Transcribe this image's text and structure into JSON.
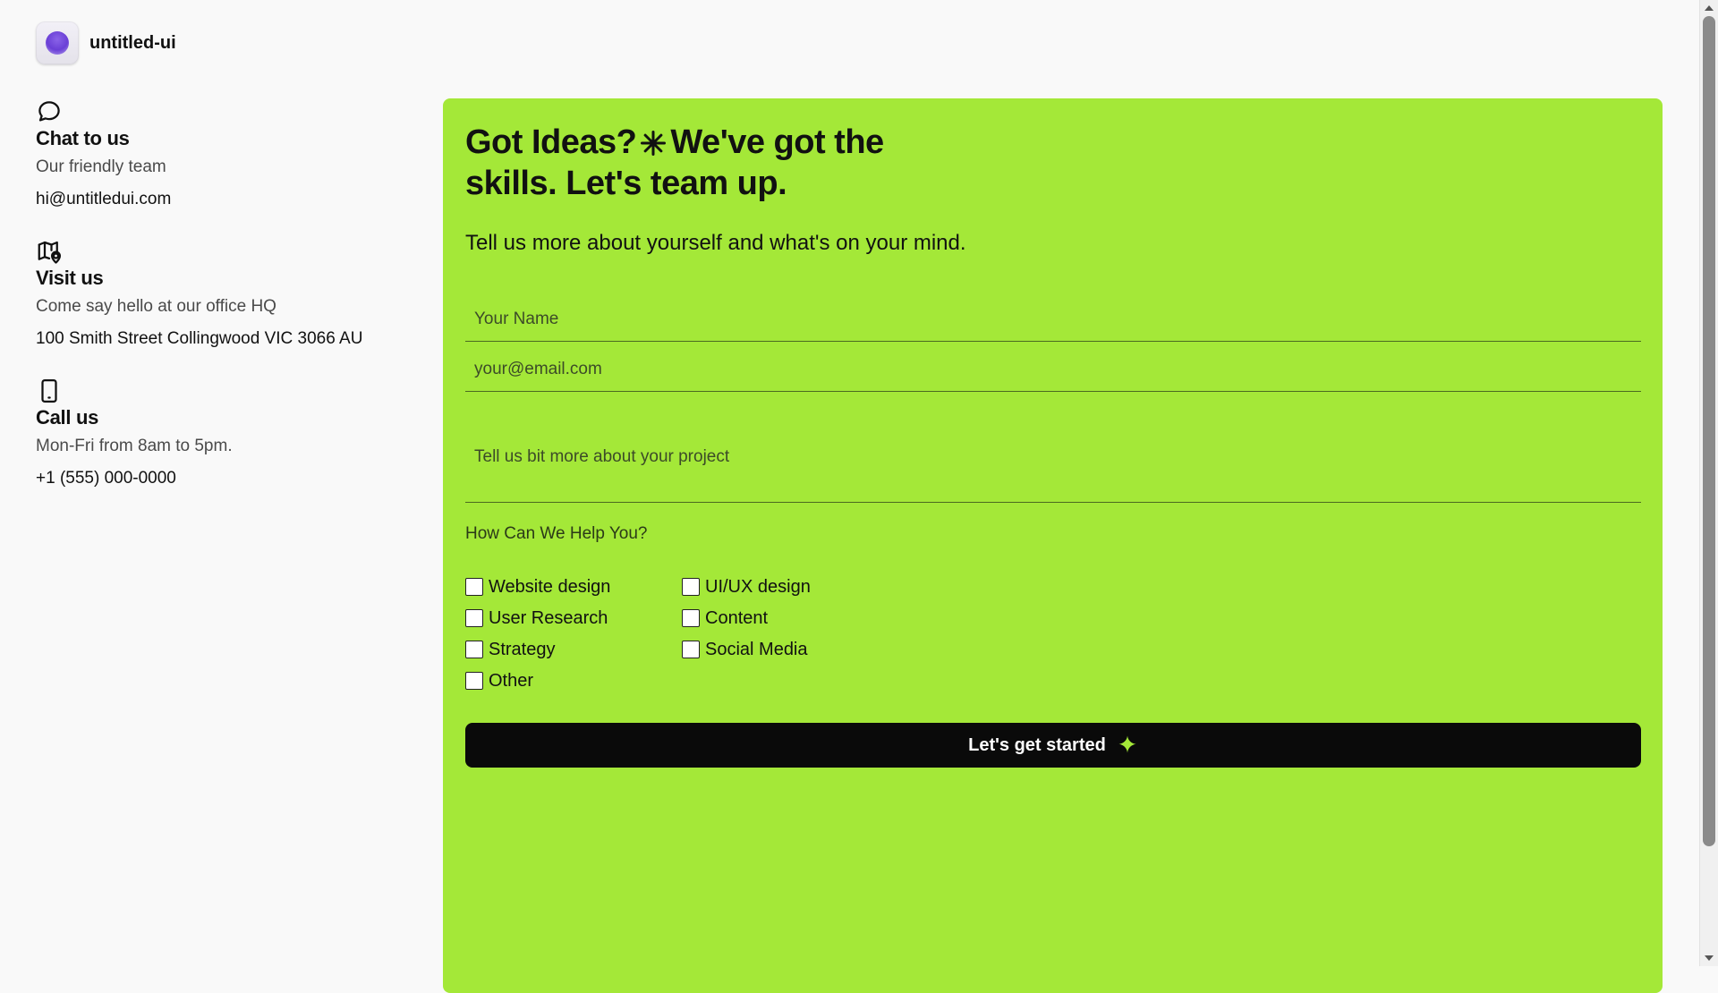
{
  "brand": {
    "name": "untitled-ui",
    "logo_icon": "gradient-circle-logo"
  },
  "contact": [
    {
      "icon": "chat-bubble-icon",
      "title": "Chat to us",
      "description": "Our friendly team",
      "value": "hi@untitledui.com"
    },
    {
      "icon": "map-pin-icon",
      "title": "Visit us",
      "description": "Come say hello at our office HQ",
      "value": "100 Smith Street Collingwood VIC 3066 AU"
    },
    {
      "icon": "phone-icon",
      "title": "Call us",
      "description": "Mon-Fri from 8am to 5pm.",
      "value": "+1 (555) 000-0000"
    }
  ],
  "form": {
    "headline_part1": "Got Ideas?",
    "headline_part2": "We've got the skills. Let's team up.",
    "subheading": "Tell us more about yourself and what's on your mind.",
    "name_placeholder": "Your Name",
    "email_placeholder": "your@email.com",
    "message_placeholder": "Tell us bit more about your project",
    "help_label": "How Can We Help You?",
    "options": [
      "Website design",
      "UI/UX design",
      "User Research",
      "Content",
      "Strategy",
      "Social Media",
      "Other"
    ],
    "submit_label": "Let's get started"
  },
  "colors": {
    "accent": "#a4e838",
    "button": "#0a0a0a",
    "background": "#f9f9f9",
    "logo": "#6a3fd6"
  }
}
